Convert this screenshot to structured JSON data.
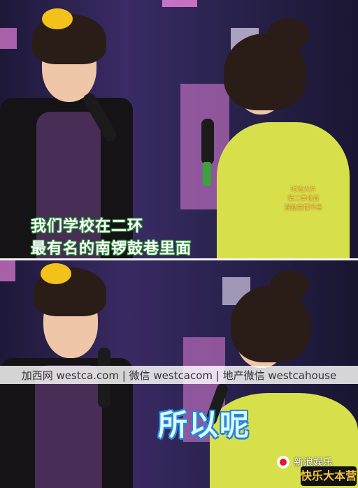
{
  "top_frame": {
    "subtitle_line1": "我们学校在二环",
    "subtitle_line2": "最有名的南锣鼓巷里面",
    "corner_badge": [
      "时光大片",
      "第二季收官",
      "鼓励直播节目"
    ]
  },
  "watermark": {
    "text": "加西网 westca.com | 微信 westcacom | 地产微信 westcahouse"
  },
  "bottom_frame": {
    "caption": "所以呢",
    "weibo_label": "新浪娱乐",
    "corner_logo": "快乐大本营"
  },
  "colors": {
    "subtitle_outline": "#2a8a35",
    "caption_fill": "#d8fbff",
    "caption_outline": "#2b84d8",
    "yellow_top": "#d7e04a",
    "stage_pink": "#e27fd8"
  }
}
